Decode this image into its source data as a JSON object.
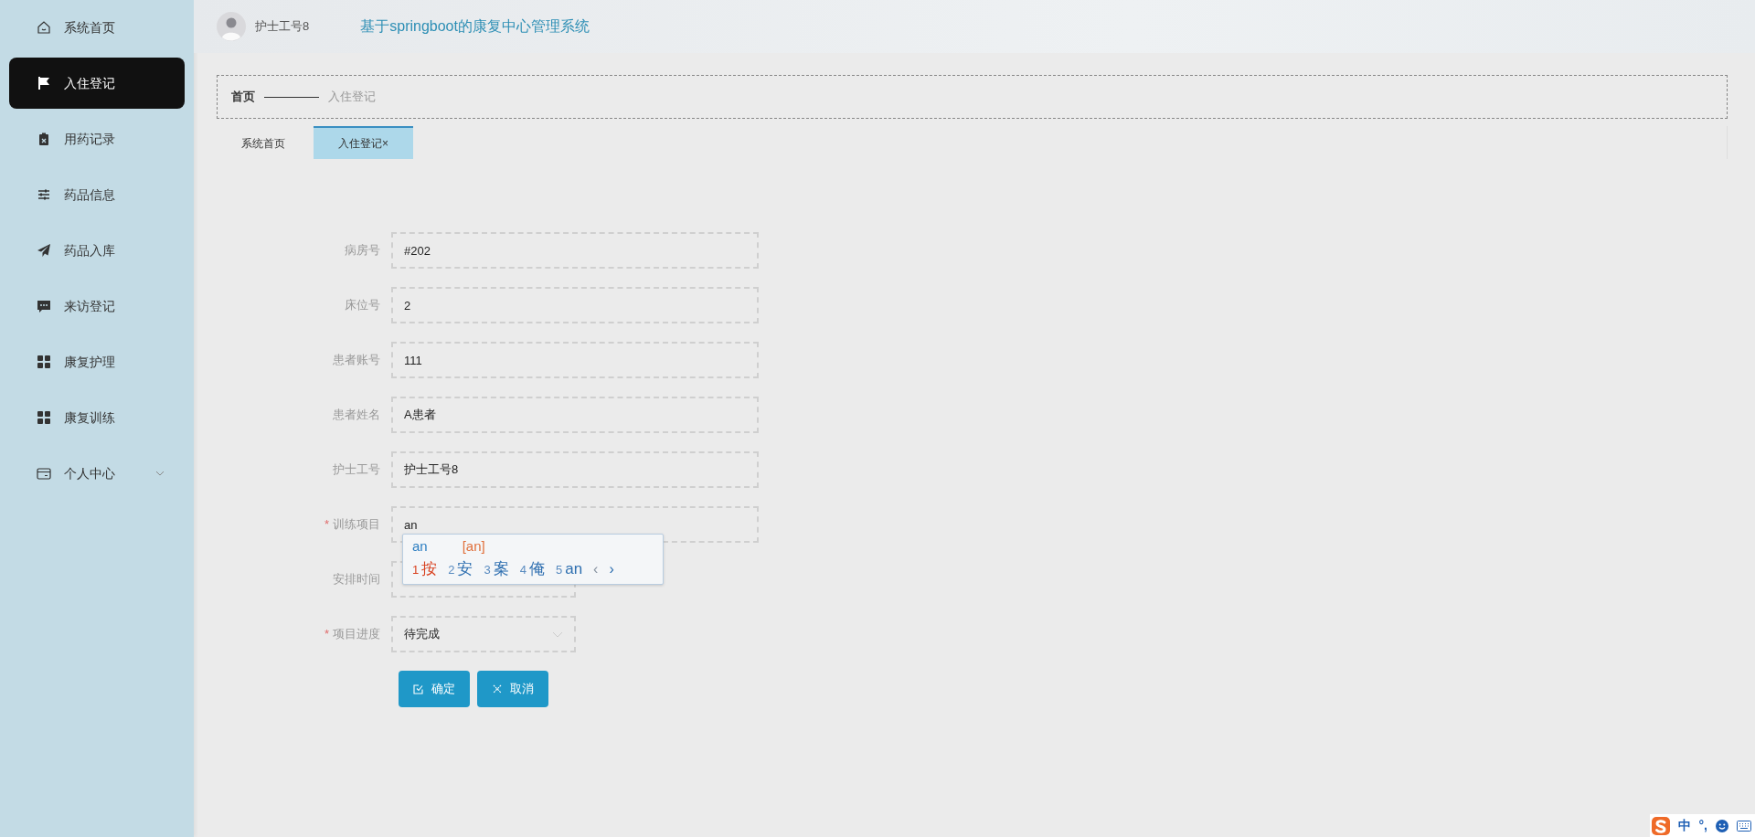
{
  "header": {
    "user_name": "护士工号8",
    "title": "基于springboot的康复中心管理系统"
  },
  "sidebar": {
    "items": [
      {
        "label": "系统首页",
        "selected": false,
        "kind": "link"
      },
      {
        "label": "入住登记",
        "selected": true,
        "kind": "link"
      },
      {
        "label": "用药记录",
        "selected": false,
        "kind": "link"
      },
      {
        "label": "药品信息",
        "selected": false,
        "kind": "link"
      },
      {
        "label": "药品入库",
        "selected": false,
        "kind": "link"
      },
      {
        "label": "来访登记",
        "selected": false,
        "kind": "link"
      },
      {
        "label": "康复护理",
        "selected": false,
        "kind": "link"
      },
      {
        "label": "康复训练",
        "selected": false,
        "kind": "link"
      },
      {
        "label": "个人中心",
        "selected": false,
        "kind": "submenu"
      }
    ]
  },
  "breadcrumb": [
    {
      "label": "首页",
      "kind": "root"
    },
    {
      "label": "入住登记",
      "kind": "current"
    }
  ],
  "tabs": [
    {
      "label": "系统首页",
      "selected": false
    },
    {
      "label": "入住登记",
      "selected": true,
      "close_glyph": "×"
    }
  ],
  "form": {
    "fields": [
      {
        "label": "病房号",
        "kind": "text",
        "value": "#202"
      },
      {
        "label": "床位号",
        "kind": "text",
        "value": "2"
      },
      {
        "label": "患者账号",
        "kind": "text",
        "value": "111"
      },
      {
        "label": "患者姓名",
        "kind": "text",
        "value": "A患者"
      },
      {
        "label": "护士工号",
        "kind": "text",
        "value": "护士工号8"
      },
      {
        "label": "训练项目",
        "kind": "text",
        "value": "an",
        "required_mark": "*"
      },
      {
        "label": "安排时间",
        "kind": "date"
      },
      {
        "label": "项目进度",
        "kind": "select",
        "value": "待完成",
        "required_mark": "*"
      }
    ],
    "buttons": [
      {
        "label": "确定",
        "kind": "confirm"
      },
      {
        "label": "取消",
        "kind": "cancel"
      }
    ]
  },
  "ime": {
    "composition": "an",
    "pinyin": "[an]",
    "candidates": [
      {
        "number": "1",
        "text": "按",
        "selected": true
      },
      {
        "number": "2",
        "text": "安",
        "selected": false
      },
      {
        "number": "3",
        "text": "案",
        "selected": false
      },
      {
        "number": "4",
        "text": "俺",
        "selected": false
      },
      {
        "number": "5",
        "text": "an",
        "selected": false
      }
    ],
    "page_prev": {
      "glyph": "‹",
      "disabled": true
    },
    "page_next": {
      "glyph": "›",
      "disabled": false
    }
  },
  "ime_toolbar": {
    "mode": "中",
    "punctuation": "°,"
  }
}
